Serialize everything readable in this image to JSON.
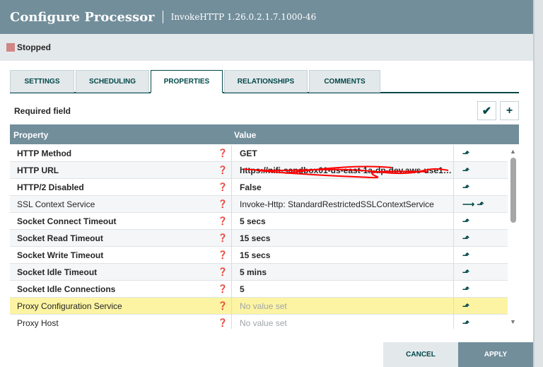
{
  "header": {
    "title": "Configure Processor",
    "subtitle": "InvokeHTTP 1.26.0.2.1.7.1000-46"
  },
  "status": {
    "label": "Stopped",
    "color": "#d18686"
  },
  "tabs": [
    {
      "label": "SETTINGS"
    },
    {
      "label": "SCHEDULING"
    },
    {
      "label": "PROPERTIES",
      "active": true
    },
    {
      "label": "RELATIONSHIPS"
    },
    {
      "label": "COMMENTS"
    }
  ],
  "toolbar": {
    "required_label": "Required field",
    "verify_icon": "check-circle-icon",
    "add_icon": "plus-icon"
  },
  "table": {
    "columns": [
      "Property",
      "Value"
    ],
    "rows": [
      {
        "name": "HTTP Method",
        "value": "GET",
        "required": true
      },
      {
        "name": "HTTP URL",
        "value": "https://nifi-sandbox01-us-east-1a-dp-dev.aws-use1…",
        "required": true,
        "redacted": true
      },
      {
        "name": "HTTP/2 Disabled",
        "value": "False",
        "required": true
      },
      {
        "name": "SSL Context Service",
        "value": "Invoke-Http: StandardRestrictedSSLContextService",
        "required": false,
        "goto": true
      },
      {
        "name": "Socket Connect Timeout",
        "value": "5 secs",
        "required": true
      },
      {
        "name": "Socket Read Timeout",
        "value": "15 secs",
        "required": true
      },
      {
        "name": "Socket Write Timeout",
        "value": "15 secs",
        "required": true
      },
      {
        "name": "Socket Idle Timeout",
        "value": "5 mins",
        "required": true
      },
      {
        "name": "Socket Idle Connections",
        "value": "5",
        "required": true
      },
      {
        "name": "Proxy Configuration Service",
        "value": "No value set",
        "required": false,
        "placeholder": true,
        "highlighted": true
      },
      {
        "name": "Proxy Host",
        "value": "No value set",
        "required": false,
        "placeholder": true
      }
    ]
  },
  "footer": {
    "cancel": "CANCEL",
    "apply": "APPLY"
  },
  "colors": {
    "header": "#728e9b",
    "accent": "#004849",
    "highlight": "#fcf4a3"
  }
}
